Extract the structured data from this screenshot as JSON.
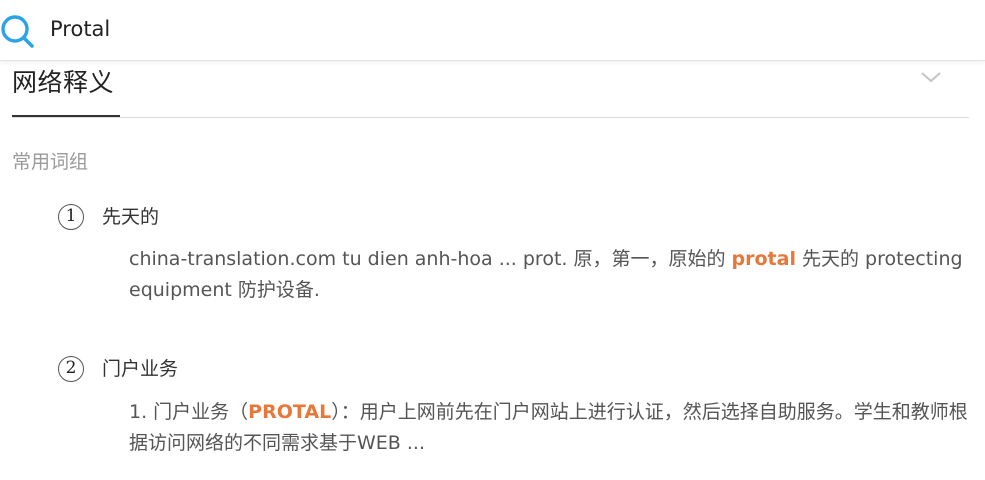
{
  "search": {
    "value": "Protal"
  },
  "section": {
    "title": "网络释义"
  },
  "subheading": "常用词组",
  "entries": [
    {
      "number": "1",
      "title": "先天的",
      "desc_before": "china-translation.com tu dien anh-hoa ... prot. 原，第一，原始的 ",
      "desc_highlight": "protal",
      "desc_after": " 先天的 protecting equipment 防护设备."
    },
    {
      "number": "2",
      "title": "门户业务",
      "desc_before": "1. 门户业务（",
      "desc_highlight": "PROTAL",
      "desc_after": "）：用户上网前先在门户网站上进行认证，然后选择自助服务。学生和教师根据访问网络的不同需求基于WEB ..."
    }
  ],
  "colors": {
    "accent": "#e8773a",
    "search_icon": "#2aa3e8",
    "muted_text": "#9a9a9a"
  },
  "icons": {
    "search": "search-icon",
    "expand": "chevron-down-icon"
  }
}
